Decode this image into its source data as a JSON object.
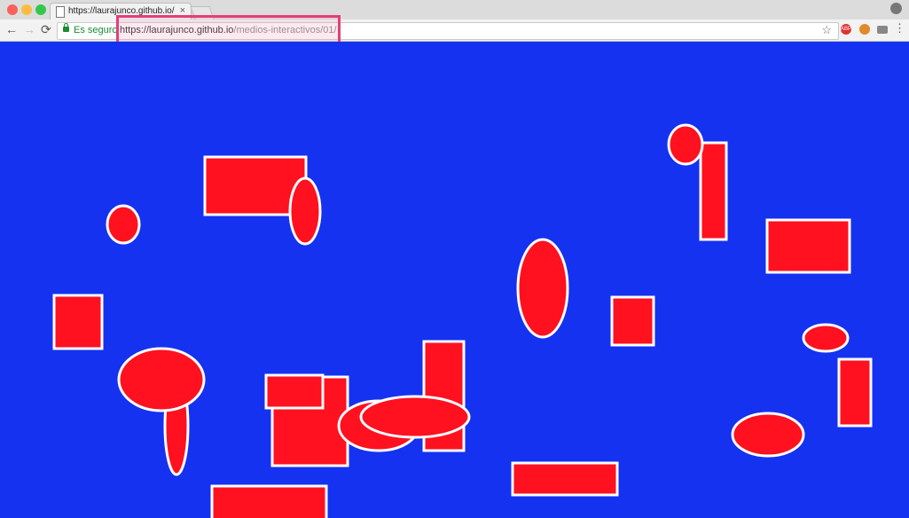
{
  "window": {
    "traffic_lights": [
      {
        "name": "close",
        "color": "#fc605b"
      },
      {
        "name": "minimize",
        "color": "#fdbc40"
      },
      {
        "name": "zoom",
        "color": "#34c84a"
      }
    ]
  },
  "tab": {
    "title": "https://laurajunco.github.io/me",
    "close_glyph": "×"
  },
  "toolbar": {
    "back_glyph": "←",
    "forward_glyph": "→",
    "reload_glyph": "⟳",
    "secure_label": "Es seguro",
    "url_host": "https://laurajunco.github.io",
    "url_path": "/medios-interactivos/01/",
    "star_glyph": "☆",
    "adblock_label": "ABP",
    "menu_glyph": "⋮"
  },
  "annotation": {
    "highlight_color": "#e33f78"
  },
  "canvas": {
    "background": "#1432f0",
    "shape_fill": "#ff1120",
    "shape_stroke": "#ffffff"
  }
}
